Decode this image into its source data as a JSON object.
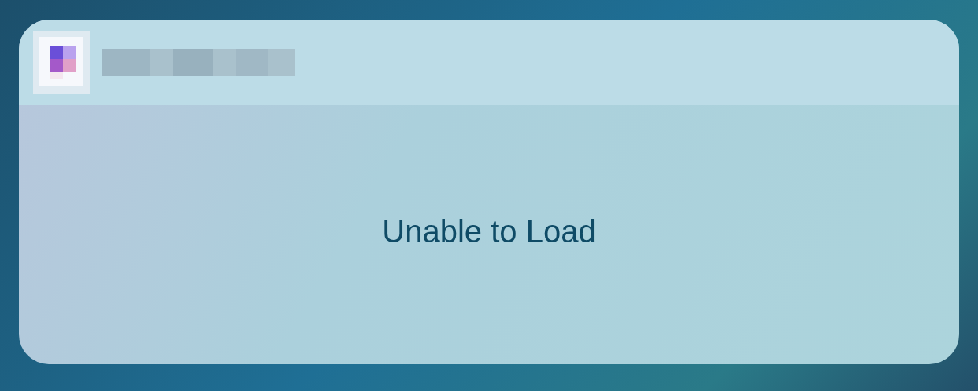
{
  "widget": {
    "message": "Unable to Load"
  }
}
